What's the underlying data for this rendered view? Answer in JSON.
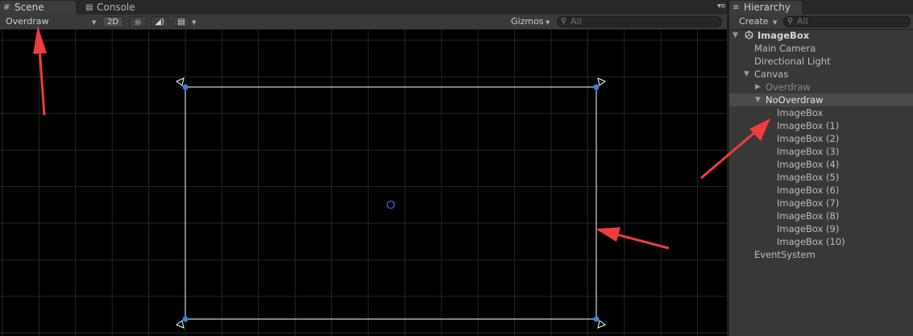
{
  "scene_panel": {
    "tabs": [
      {
        "label": "Scene",
        "icon": "grid-icon",
        "active": true
      },
      {
        "label": "Console",
        "icon": "console-icon",
        "active": false
      }
    ],
    "toolbar": {
      "draw_mode": "Overdraw",
      "mode_2d": "2D",
      "lighting_icon": "sun-icon",
      "audio_icon": "speaker-icon",
      "effects_icon": "image-icon",
      "gizmos": "Gizmos",
      "search_placeholder": "All"
    }
  },
  "hierarchy": {
    "tab_label": "Hierarchy",
    "tab_icon": "hierarchy-icon",
    "create": "Create",
    "search_placeholder": "All",
    "items": [
      {
        "label": "ImageBox",
        "depth": 0,
        "expanded": true,
        "root": true
      },
      {
        "label": "Main Camera",
        "depth": 1
      },
      {
        "label": "Directional Light",
        "depth": 1
      },
      {
        "label": "Canvas",
        "depth": 1,
        "expanded": true
      },
      {
        "label": "Overdraw",
        "depth": 2,
        "expanded": false,
        "dim": true
      },
      {
        "label": "NoOverdraw",
        "depth": 2,
        "expanded": true,
        "selected": true
      },
      {
        "label": "ImageBox",
        "depth": 3
      },
      {
        "label": "ImageBox (1)",
        "depth": 3
      },
      {
        "label": "ImageBox (2)",
        "depth": 3
      },
      {
        "label": "ImageBox (3)",
        "depth": 3
      },
      {
        "label": "ImageBox (4)",
        "depth": 3
      },
      {
        "label": "ImageBox (5)",
        "depth": 3
      },
      {
        "label": "ImageBox (6)",
        "depth": 3
      },
      {
        "label": "ImageBox (7)",
        "depth": 3
      },
      {
        "label": "ImageBox (8)",
        "depth": 3
      },
      {
        "label": "ImageBox (9)",
        "depth": 3
      },
      {
        "label": "ImageBox (10)",
        "depth": 3
      },
      {
        "label": "EventSystem",
        "depth": 1
      }
    ]
  },
  "colors": {
    "scene_background": "#000000",
    "grid_line": "#2a2a2a",
    "rect_outline": "#ffffff",
    "handle_fill": "#3a7fd8",
    "annotation_arrow": "#f03c3c",
    "selection": "#4a4a4a"
  }
}
